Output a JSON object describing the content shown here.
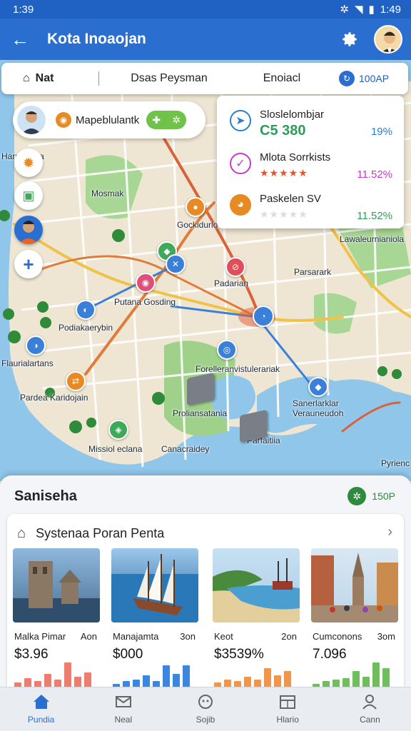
{
  "status": {
    "time": "1:39",
    "right_time": "1:49"
  },
  "app": {
    "title": "Kota Inoaojan"
  },
  "filters": {
    "f1": "Nat",
    "f2": "Dsas Peysman",
    "f3": "Enoiacl",
    "f4": "100AP"
  },
  "map_card": {
    "label": "Mapeblulantk"
  },
  "poi": [
    {
      "name": "Sloslelombjar",
      "value": "C5 380",
      "pct": "19%",
      "color": "#2a7fd0"
    },
    {
      "name": "Mlota Sorrkists",
      "stars": "★★★★★",
      "pct": "11.52%",
      "color": "#c73ac9"
    },
    {
      "name": "Paskelen SV",
      "stars": "★★★★★",
      "pct": "11.52%",
      "color": "#e88a23"
    }
  ],
  "map_labels": {
    "hart": "Harr Viania",
    "mosmak": "Mosmak",
    "gockidurlo": "Gockidurlo",
    "padarian": "Padarian",
    "parsarak": "Parsarark",
    "lawale": "Lawaleurnianiola",
    "putana": "Putana Gosding",
    "podlia": "Podiakaerybin",
    "flaura": "Flaurialartans",
    "pardea": "Pardea Karidojain",
    "forel": "Forelleranvistulerariak",
    "prolians": "Proliansatania",
    "sanerh": "Sanerlarklar Verauneudoh",
    "parfitia": "Parfaitiia",
    "missiol": "Missiol eclana",
    "canacard": "Canacraidey",
    "pyrien": "Pyrienc"
  },
  "sheet": {
    "title": "Saniseha",
    "badge": "150P"
  },
  "tours": {
    "title": "Systenaa Poran Penta",
    "items": [
      {
        "name": "Malka Pimar",
        "dur": "Aon",
        "price": "$3.96",
        "bar_color": "#ee7d6e",
        "bars": [
          0.2,
          0.35,
          0.25,
          0.5,
          0.3,
          0.9,
          0.4,
          0.55
        ]
      },
      {
        "name": "Manajamta",
        "dur": "3on",
        "price": "$000",
        "bar_color": "#3a86e0",
        "bars": [
          0.15,
          0.25,
          0.3,
          0.45,
          0.25,
          0.8,
          0.5,
          0.8
        ]
      },
      {
        "name": "Keot",
        "dur": "2on",
        "price": "$3539%",
        "bar_color": "#f0954a",
        "bars": [
          0.2,
          0.3,
          0.25,
          0.4,
          0.3,
          0.7,
          0.45,
          0.6
        ]
      },
      {
        "name": "Cumconons",
        "dur": "3om",
        "price": "7.096",
        "bar_color": "#6fbe5c",
        "bars": [
          0.15,
          0.25,
          0.3,
          0.35,
          0.6,
          0.4,
          0.9,
          0.7
        ]
      }
    ]
  },
  "nav": [
    {
      "label": "Pundia",
      "icon": "home-icon",
      "active": true
    },
    {
      "label": "Neal",
      "icon": "mail-icon",
      "active": false
    },
    {
      "label": "Sojib",
      "icon": "pet-icon",
      "active": false
    },
    {
      "label": "Hlario",
      "icon": "calendar-icon",
      "active": false
    },
    {
      "label": "Cann",
      "icon": "profile-icon",
      "active": false
    }
  ]
}
